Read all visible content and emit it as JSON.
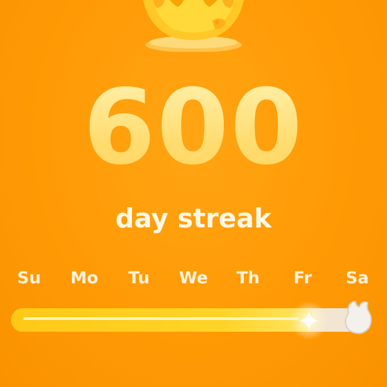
{
  "streak": {
    "count": "600",
    "label": "day streak"
  },
  "week": {
    "days": [
      "Su",
      "Mo",
      "Tu",
      "We",
      "Th",
      "Fr",
      "Sa"
    ]
  },
  "progress": {
    "fraction": 0.857
  },
  "icons": {
    "mascot": "flame-mascot-icon",
    "sparkle": "sparkle-icon",
    "goal": "flame-outline-icon"
  },
  "colors": {
    "background": "#FF9A05",
    "number": "#FFE489",
    "label": "#FFF8E6",
    "track": "#F2E6D2",
    "fill": "#FFC816"
  }
}
